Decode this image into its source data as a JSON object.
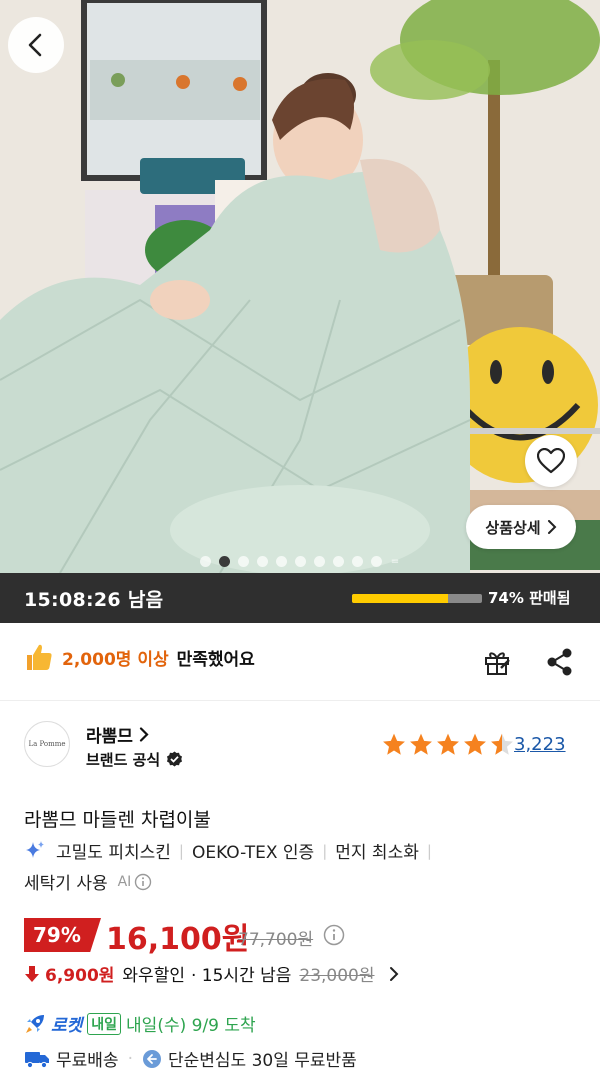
{
  "hero": {
    "image_alt": "Woman wrapped in mint quilted comforter",
    "page_count_dots": 10,
    "active_dot": 1,
    "detail_button_label": "상품상세",
    "colors": {
      "comforter": "#c9dcd0",
      "accent": "#f0c93a"
    }
  },
  "timer": {
    "remaining": "15:08:26 남음",
    "sold_progress": 0.74,
    "sold_label": "74% 판매됨"
  },
  "satisfaction": {
    "highlight": "2,000명 이상",
    "suffix": "만족했어요"
  },
  "brand": {
    "logo_text": "La Pomme",
    "name": "라뽐므",
    "official": "브랜드 공식",
    "rating": 4.5,
    "review_count": "3,223"
  },
  "product": {
    "title": "라뽐므 마들렌 차렵이불",
    "tags_line1": [
      "고밀도 피치스킨",
      "OEKO-TEX 인증",
      "먼지 최소화"
    ],
    "tags_line2": [
      "세탁기 사용"
    ],
    "ai_label": "AI"
  },
  "price": {
    "discount": "79%",
    "sale": "16,100원",
    "original": "77,700원",
    "wow_amount": "6,900원",
    "wow_label": "와우할인",
    "wow_time": "· 15시간 남음",
    "wow_original": "23,000원"
  },
  "delivery": {
    "rocket": "로켓",
    "badge": "내일",
    "arrival": "내일(수) 9/9 도착",
    "free_shipping": "무료배송",
    "return_label": "단순변심도 30일 무료반품"
  },
  "colors": {
    "red": "#d01f1f",
    "orange": "#e2640c",
    "blue": "#1b58a8",
    "green": "#2ea44f",
    "star": "#f5821f"
  }
}
